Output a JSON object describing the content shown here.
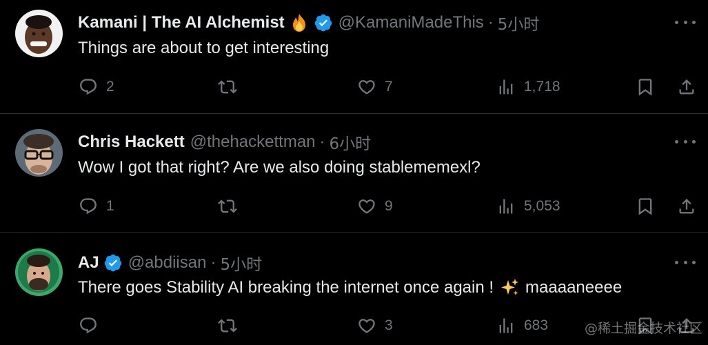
{
  "tweets": [
    {
      "name": "Kamani | The AI Alchemist",
      "emoji": "fire-emoji",
      "verified": true,
      "handle": "@KamaniMadeThis",
      "separator": "·",
      "time": "5小时",
      "text": "Things are about to get interesting",
      "replies": "2",
      "retweets": "",
      "likes": "7",
      "views": "1,718"
    },
    {
      "name": "Chris Hackett",
      "verified": false,
      "handle": "@thehackettman",
      "separator": "·",
      "time": "6小时",
      "text": "Wow I got that right? Are we also doing stablememexl?",
      "replies": "1",
      "retweets": "",
      "likes": "9",
      "views": "5,053"
    },
    {
      "name": "AJ",
      "verified": true,
      "handle": "@abdiisan",
      "separator": "·",
      "time": "5小时",
      "text": "There goes Stability AI breaking the internet once again !",
      "text_suffix": "maaaaneeee",
      "replies": "",
      "retweets": "",
      "likes": "3",
      "views": "683"
    }
  ],
  "watermark": "@稀土掘金技术社区",
  "colors": {
    "background": "#000000",
    "text": "#e7e9ea",
    "secondary": "#71767b",
    "verified": "#1d9bf0",
    "divider": "#2f3336"
  }
}
